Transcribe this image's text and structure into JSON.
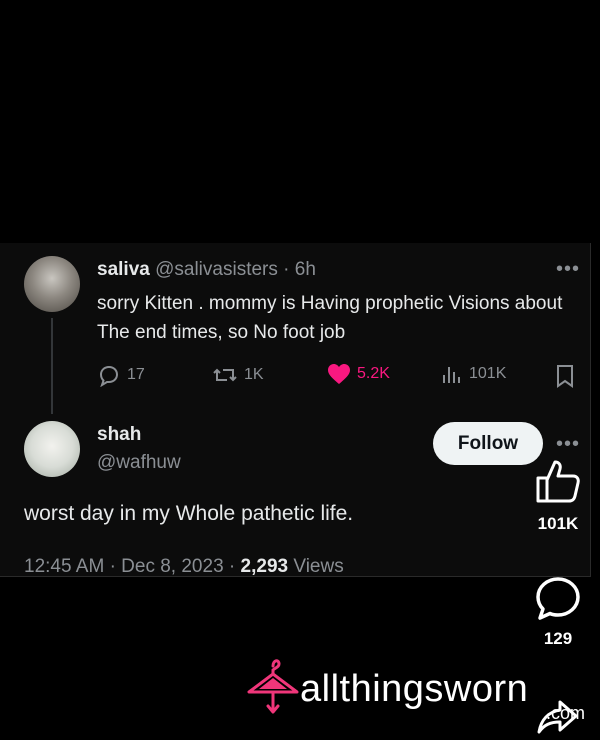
{
  "reply": {
    "name": "saliva",
    "handle": "@salivasisters",
    "separator": "·",
    "time": "6h",
    "text": "sorry Kitten . mommy is  Having prophetic Visions about The end times, so No foot job",
    "stats": {
      "replies": "17",
      "reposts": "1K",
      "likes": "5.2K",
      "views": "101K"
    }
  },
  "post": {
    "name": "shah",
    "handle": "@wafhuw",
    "follow_label": "Follow",
    "text": "worst day in my Whole pathetic life.",
    "time": "12:45 AM",
    "separator": "·",
    "date": "Dec 8, 2023",
    "views_count": "2,293",
    "views_label": "Views"
  },
  "side_actions": {
    "likes_count": "101K",
    "comments_count": "129"
  },
  "watermark": {
    "brand": "allthingsworn",
    "domain": ".com"
  },
  "icons": [
    "reply-icon",
    "repost-icon",
    "heart-icon",
    "views-icon",
    "bookmark-icon",
    "more-icon",
    "thumbs-up-icon",
    "comment-bubble-icon",
    "share-icon",
    "hanger-icon"
  ],
  "colors": {
    "like_pink": "#f91880",
    "follow_bg": "#eff3f4",
    "muted_text": "#8b8f94"
  }
}
